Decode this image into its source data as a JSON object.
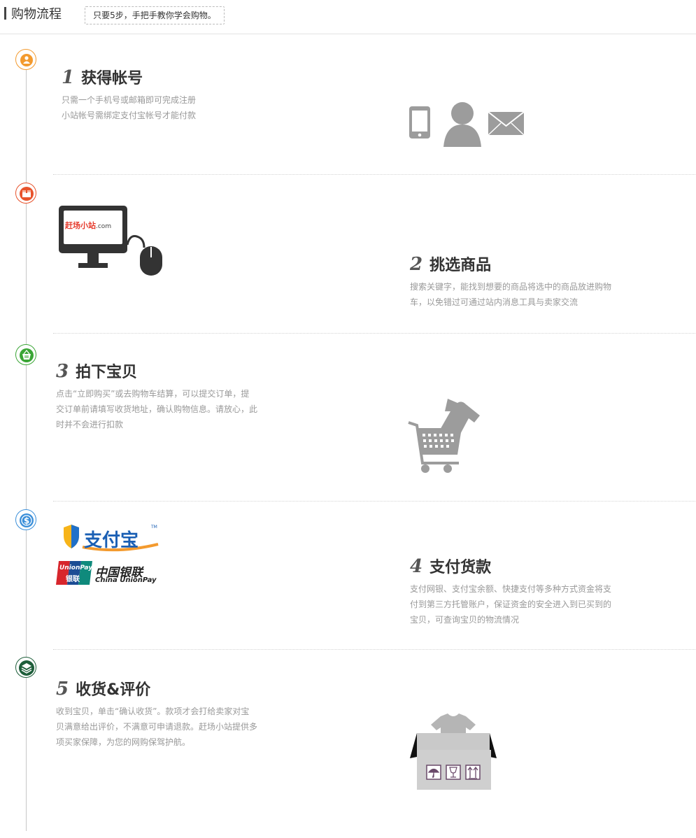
{
  "header": {
    "title": "购物流程",
    "tip": "只要5步，手把手教你学会购物。"
  },
  "steps": [
    {
      "num": "1",
      "title": "获得帐号",
      "lines": [
        "只需一个手机号或邮箱即可完成注册",
        "小站帐号需绑定支付宝帐号才能付款"
      ]
    },
    {
      "num": "2",
      "title": "挑选商品",
      "lines": [
        "搜索关键字，能找到想要的商品将选中的商品放进购物",
        "车，以免错过可通过站内消息工具与卖家交流"
      ]
    },
    {
      "num": "3",
      "title": "拍下宝贝",
      "lines": [
        "点击“立即购买”或去购物车结算，可以提交订单，提",
        "交订单前请填写收货地址，确认购物信息。请放心，此",
        "时并不会进行扣款"
      ]
    },
    {
      "num": "4",
      "title": "支付货款",
      "lines": [
        "支付网银、支付宝余额、快捷支付等多种方式资金将支",
        "付到第三方托管账户，保证资金的安全进入到已买到的",
        "宝贝，可查询宝贝的物流情况"
      ]
    },
    {
      "num": "5",
      "title": "收货&评价",
      "lines": [
        "收到宝贝，单击“确认收货”。款项才会打给卖家对宝",
        "贝满意给出评价，不满意可申请退款。赶场小站提供多",
        "项买家保障，为您的网购保驾护航。"
      ]
    }
  ],
  "logos": {
    "site": "赶场小站",
    "site_suffix": ".com",
    "alipay": "支付宝",
    "tm": "TM",
    "unionpay_cn": "中国银联",
    "unionpay_en": "China UnionPay",
    "unionpay_card_en": "UnionPay",
    "unionpay_card_cn": "银联"
  },
  "colors": {
    "step1": "#f39a2e",
    "step2": "#e8532c",
    "step3": "#3aa535",
    "step4": "#3b8fd9",
    "step5": "#1e5e3a",
    "icon_gray": "#9c9c9c",
    "monitor": "#333333"
  }
}
